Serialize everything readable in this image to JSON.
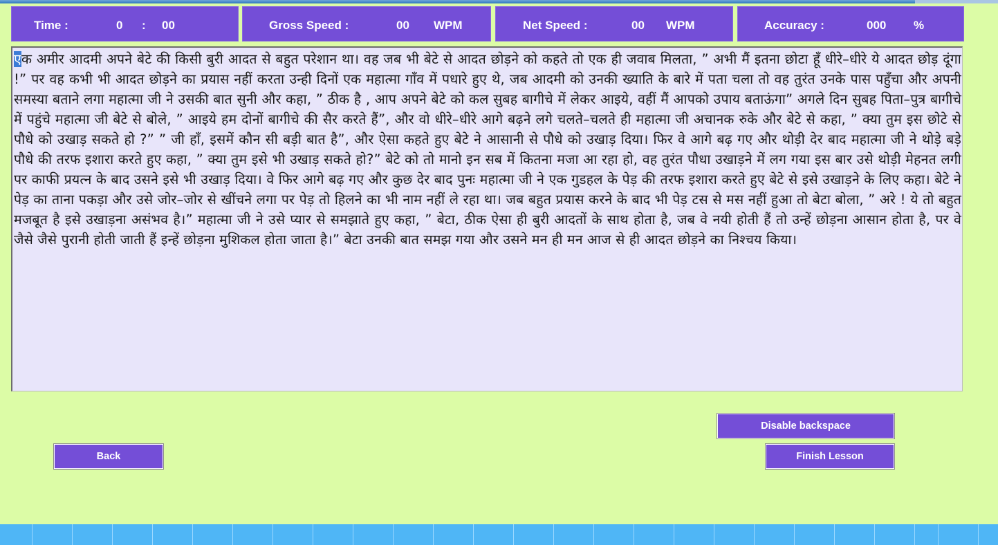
{
  "stats": {
    "time_label": "Time :",
    "time_minutes": "0",
    "time_separator": ":",
    "time_seconds": "00",
    "gross_label": "Gross Speed :",
    "gross_value": "00",
    "gross_unit": "WPM",
    "net_label": "Net Speed :",
    "net_value": "00",
    "net_unit": "WPM",
    "accuracy_label": "Accuracy :",
    "accuracy_value": "000",
    "accuracy_unit": "%"
  },
  "lesson": {
    "first_char": "ए",
    "text_rest": "क अमीर आदमी अपने बेटे की किसी बुरी आदत से बहुत परेशान था। वह जब भी बेटे से आदत छोड़ने को कहते तो एक ही जवाब मिलता, ” अभी मैं इतना छोटा हूँ धीरे–धीरे ये आदत छोड़ दूंगा !” पर वह कभी भी आदत छोड़ने का प्रयास नहीं करता उन्ही दिनों एक महात्मा गाँव में पधारे हुए थे, जब आदमी को उनकी ख्याति के बारे में पता चला तो वह तुरंत उनके पास पहुँचा और अपनी समस्या बताने लगा महात्मा जी ने उसकी बात सुनी और कहा, ” ठीक है , आप अपने बेटे को कल सुबह बागीचे में लेकर आइये, वहीं मैं आपको उपाय बताऊंगा” अगले दिन सुबह पिता–पुत्र बागीचे में पहुंचे महात्मा जी बेटे से बोले, ” आइये हम दोनों बागीचे की सैर करते हैं”, और वो धीरे–धीरे आगे बढ़ने लगे चलते–चलते ही महात्मा जी अचानक रुके और बेटे से कहा, ” क्या तुम इस छोटे से पौधे को उखाड़ सकते हो ?” ” जी हाँ, इसमें कौन सी बड़ी बात है”, और ऐसा कहते हुए बेटे ने आसानी से पौधे को उखाड़ दिया। फिर वे आगे बढ़ गए और थोड़ी देर बाद महात्मा जी ने थोड़े बड़े पौधे की तरफ इशारा करते हुए कहा, ” क्या तुम इसे भी उखाड़ सकते हो?” बेटे को तो मानो इन सब में कितना मजा आ रहा हो, वह तुरंत पौधा उखाड़ने में लग गया इस बार उसे थोड़ी मेहनत लगी पर काफी प्रयत्न के बाद उसने इसे भी उखाड़ दिया। वे फिर आगे बढ़ गए और कुछ देर बाद पुनः महात्मा जी ने एक गुडहल के पेड़ की तरफ इशारा करते हुए बेटे से इसे उखाड़ने के लिए कहा। बेटे ने पेड़ का ताना पकड़ा और उसे जोर–जोर से खींचने लगा पर पेड़ तो हिलने का भी नाम नहीं ले रहा था। जब बहुत प्रयास करने के बाद भी पेड़ टस से मस नहीं हुआ तो बेटा बोला, ” अरे ! ये तो बहुत मजबूत है इसे उखाड़ना असंभव है।” महात्मा जी ने उसे प्यार से समझाते हुए कहा, ” बेटा, ठीक ऐसा ही बुरी आदतों के साथ होता है, जब वे नयी होती हैं तो उन्हें छोड़ना आसान होता है, पर वे जैसे जैसे  पुरानी होती जाती हैं इन्हें छोड़ना मुशिकल होता जाता है।” बेटा उनकी बात समझ गया और उसने मन ही मन आज से ही आदत छोड़ने का निश्चय किया।"
  },
  "buttons": {
    "disable_backspace": "Disable backspace",
    "back": "Back",
    "finish_lesson": "Finish Lesson"
  },
  "colors": {
    "background": "#dcfca6",
    "accent": "#744ed7",
    "text_area": "#e8e5fa",
    "taskbar": "#4fb6f6"
  }
}
